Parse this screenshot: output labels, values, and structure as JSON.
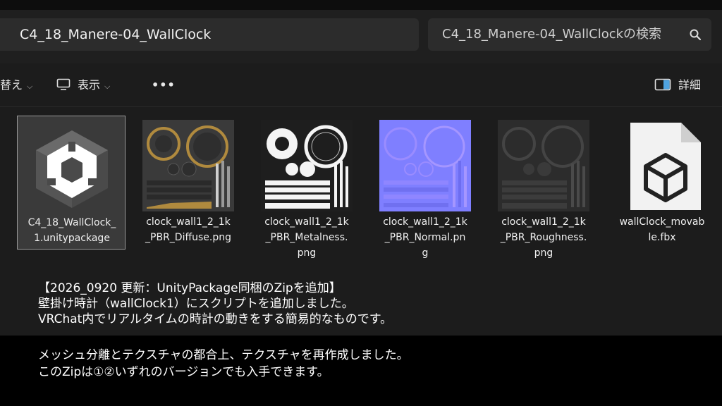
{
  "address": {
    "path": "C4_18_Manere-04_WallClock"
  },
  "search": {
    "placeholder": "C4_18_Manere-04_WallClockの検索"
  },
  "toolbar": {
    "sort_label": "替え",
    "view_label": "表示",
    "more_label": "•••",
    "details_label": "詳細"
  },
  "files": [
    {
      "name_line1": "C4_18_WallClock_",
      "name_line2": "1.unitypackage",
      "name_line3": ""
    },
    {
      "name_line1": "clock_wall1_2_1k",
      "name_line2": "_PBR_Diffuse.png",
      "name_line3": ""
    },
    {
      "name_line1": "clock_wall1_2_1k",
      "name_line2": "_PBR_Metalness.",
      "name_line3": "png"
    },
    {
      "name_line1": "clock_wall1_2_1k",
      "name_line2": "_PBR_Normal.pn",
      "name_line3": "g"
    },
    {
      "name_line1": "clock_wall1_2_1k",
      "name_line2": "_PBR_Roughness.",
      "name_line3": "png"
    },
    {
      "name_line1": "wallClock_movab",
      "name_line2": "le.fbx",
      "name_line3": ""
    }
  ],
  "notes": [
    "【2026_0920 更新：UnityPackage同梱のZipを追加】",
    "壁掛け時計（wallClock1）にスクリプトを追加しました。",
    "VRChat内でリアルタイムの時計の動きをする簡易的なものです。"
  ],
  "caption": [
    "メッシュ分離とテクスチャの都合上、テクスチャを再作成しました。",
    "このZipは①②いずれのバージョンでも入手できます。"
  ],
  "colors": {
    "diffuse_gold": "#b08a3e",
    "normal_blue": "#7f7fff",
    "metal_white": "#f4f4f4",
    "rough_gray": "#444444"
  }
}
